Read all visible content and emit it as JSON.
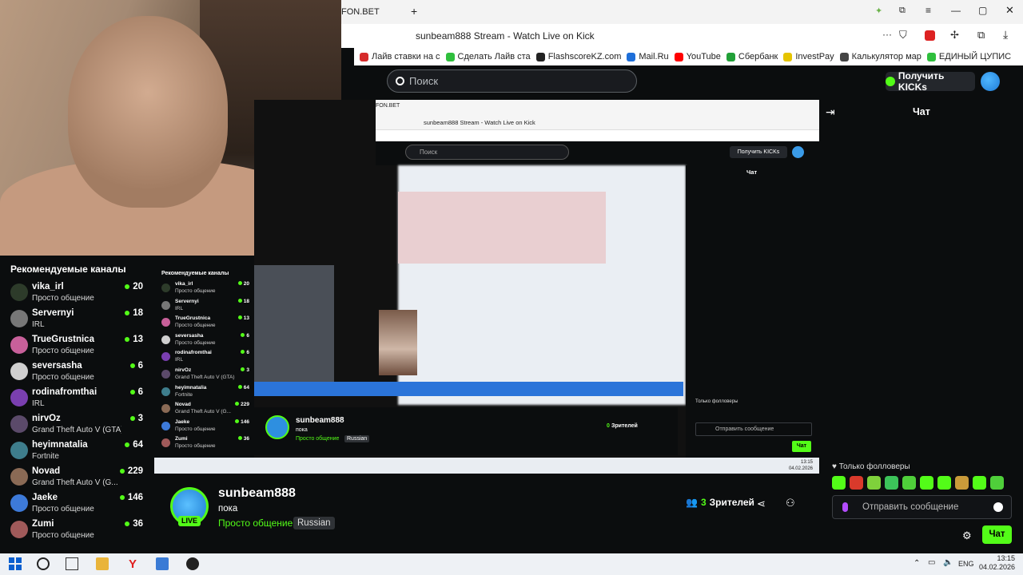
{
  "browser": {
    "tab_label": "FON.BET",
    "new_tab": "+",
    "page_title": "sunbeam888 Stream - Watch Live on Kick",
    "bookmarks": [
      {
        "label": "Лайв ставки на с",
        "color": "#d62b2b"
      },
      {
        "label": "Сделать Лайв ста",
        "color": "#2fbf3d"
      },
      {
        "label": "FlashscoreKZ.com",
        "color": "#222222"
      },
      {
        "label": "Mail.Ru",
        "color": "#1e6fd9"
      },
      {
        "label": "YouTube",
        "color": "#ff0000"
      },
      {
        "label": "Сбербанк",
        "color": "#21a038"
      },
      {
        "label": "InvestPay",
        "color": "#e5c400"
      },
      {
        "label": "Калькулятор мар",
        "color": "#444444"
      },
      {
        "label": "ЕДИНЫЙ ЦУПИС",
        "color": "#2fbf3d"
      }
    ]
  },
  "kick": {
    "search_placeholder": "Поиск",
    "kicks_button": "Получить KICKs",
    "accent_color": "#53fc18"
  },
  "recommended": {
    "title": "Рекомендуемые каналы",
    "channels": [
      {
        "name": "vika_irl",
        "category": "Просто общение",
        "viewers": "20",
        "color": "#2d3b2a"
      },
      {
        "name": "Servernyi",
        "category": "IRL",
        "viewers": "18",
        "color": "#777777"
      },
      {
        "name": "TrueGrustnica",
        "category": "Просто общение",
        "viewers": "13",
        "color": "#c8609a"
      },
      {
        "name": "seversasha",
        "category": "Просто общение",
        "viewers": "6",
        "color": "#cfcfcf"
      },
      {
        "name": "rodinafromthai",
        "category": "IRL",
        "viewers": "6",
        "color": "#7a3fb0"
      },
      {
        "name": "nirvOz",
        "category": "Grand Theft Auto V (GTA)",
        "viewers": "3",
        "color": "#5b4a6a"
      },
      {
        "name": "heyimnatalia",
        "category": "Fortnite",
        "viewers": "64",
        "color": "#3e7d8c"
      },
      {
        "name": "Novad",
        "category": "Grand Theft Auto V (G...",
        "viewers": "229",
        "color": "#8a6a55"
      },
      {
        "name": "Jaeke",
        "category": "Просто общение",
        "viewers": "146",
        "color": "#3d7ad9"
      },
      {
        "name": "Zumi",
        "category": "Просто общение",
        "viewers": "36",
        "color": "#a05a5a"
      }
    ]
  },
  "stream": {
    "streamer": "sunbeam888",
    "title": "пока",
    "category": "Просто общение",
    "language": "Russian",
    "live_badge": "LIVE",
    "viewers_count": "3",
    "viewers_label": "Зрителей"
  },
  "nested": {
    "title": "Рекомендуемые каналы",
    "viewers_count": "0",
    "viewers_label": "Зрителей",
    "chat_title": "Чат",
    "followers_only": "Только фолловеры",
    "chat_placeholder": "Отправить сообщение",
    "chat_button": "Чат",
    "clock_time": "13:15",
    "clock_date": "04.02.2026"
  },
  "chat": {
    "title": "Чат",
    "followers_only": "Только фолловеры",
    "input_placeholder": "Отправить сообщение",
    "send_button": "Чат",
    "emote_colors": [
      "#53fc18",
      "#d93a2b",
      "#7fd13b",
      "#3cc45a",
      "#4fcf3a",
      "#53fc18",
      "#53fc18",
      "#c99a3a",
      "#53fc18",
      "#4fcf3a"
    ]
  },
  "taskbar": {
    "lang": "ENG",
    "time": "13:15",
    "date": "04.02.2026"
  }
}
